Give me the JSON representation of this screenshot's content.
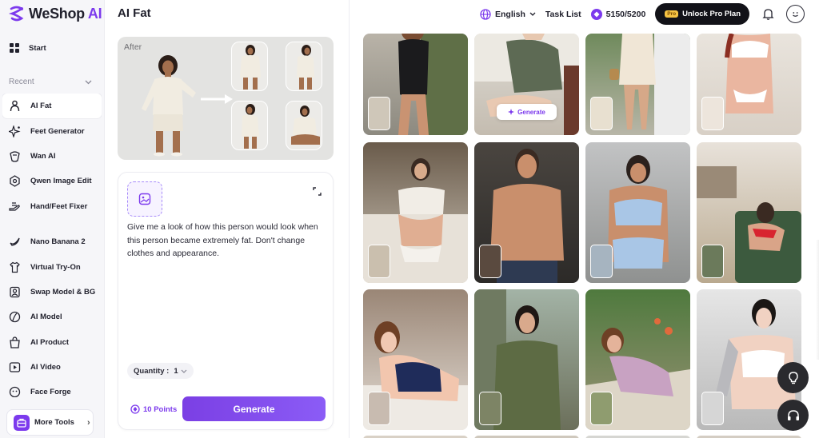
{
  "app": {
    "brand_name": "WeShop",
    "brand_suffix": "AI",
    "page_title": "AI Fat"
  },
  "header": {
    "language": "English",
    "task_list": "Task List",
    "points": "5150/5200",
    "pro_badge": "Pro",
    "unlock_label": "Unlock Pro Plan"
  },
  "sidebar": {
    "start_label": "Start",
    "recent_label": "Recent",
    "items": [
      {
        "label": "AI Fat",
        "icon": "ai-fat-icon",
        "active": true
      },
      {
        "label": "Feet Generator",
        "icon": "sparkle-icon"
      },
      {
        "label": "Wan AI",
        "icon": "wan-icon"
      },
      {
        "label": "Qwen Image Edit",
        "icon": "qwen-icon"
      },
      {
        "label": "Hand/Feet Fixer",
        "icon": "hand-icon"
      },
      {
        "label": "Nano Banana 2",
        "icon": "banana-icon"
      },
      {
        "label": "Virtual Try-On",
        "icon": "shirt-icon"
      },
      {
        "label": "Swap Model & BG",
        "icon": "swap-icon"
      },
      {
        "label": "AI Model",
        "icon": "model-icon"
      },
      {
        "label": "AI Product",
        "icon": "product-icon"
      },
      {
        "label": "AI Video",
        "icon": "video-icon"
      },
      {
        "label": "Face Forge",
        "icon": "face-icon"
      }
    ],
    "more_tools": "More Tools"
  },
  "example": {
    "after_label": "After"
  },
  "prompt": {
    "text": "Give me a look of how this person would look when this person became extremely fat. Don't change clothes and appearance.",
    "quantity_label": "Quantity :",
    "quantity_value": "1",
    "points_cost": "10 Points",
    "generate_label": "Generate"
  },
  "gallery": {
    "hover_generate": "Generate"
  },
  "colors": {
    "accent": "#7c3aed",
    "sidebar_bg": "#f6f6f9",
    "unlock_bg": "#121218"
  }
}
